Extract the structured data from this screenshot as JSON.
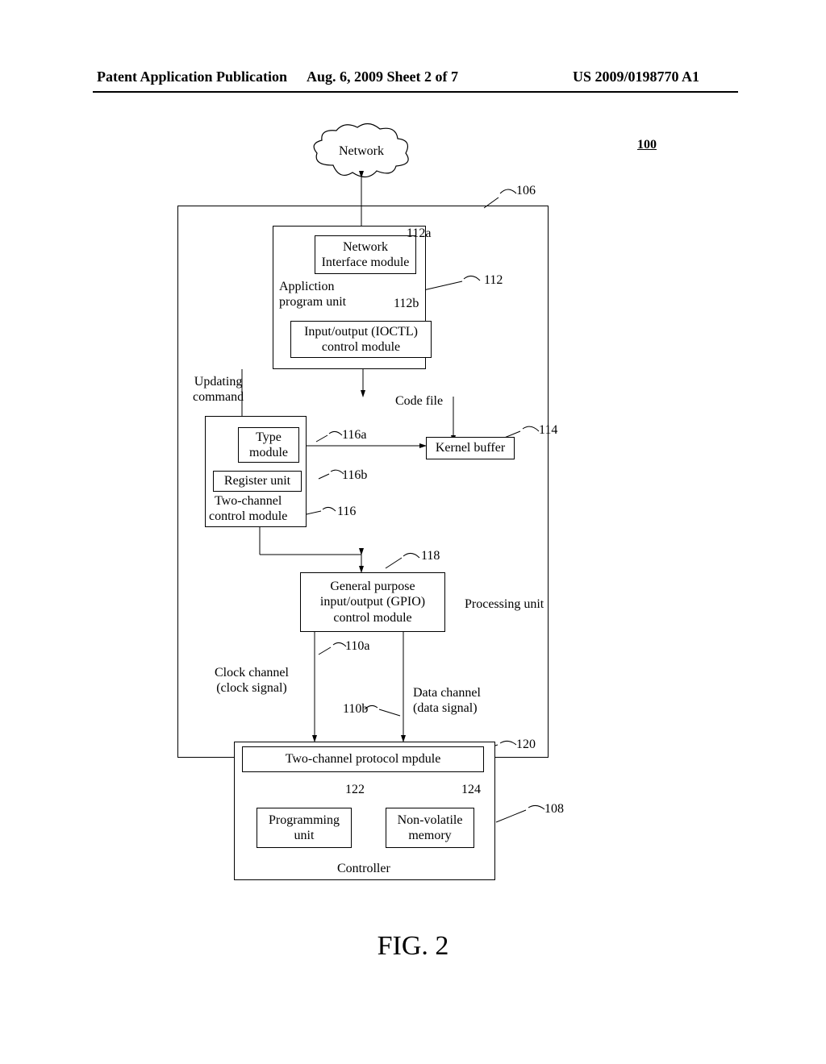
{
  "header": {
    "left": "Patent Application Publication",
    "center": "Aug. 6, 2009  Sheet 2 of 7",
    "right": "US 2009/0198770 A1"
  },
  "figure_caption": "FIG. 2",
  "refs": {
    "r100": "100",
    "r106": "106",
    "r108": "108",
    "r110a": "110a",
    "r110b": "110b",
    "r112": "112",
    "r112a": "112a",
    "r112b": "112b",
    "r114": "114",
    "r116": "116",
    "r116a": "116a",
    "r116b": "116b",
    "r118": "118",
    "r120": "120",
    "r122": "122",
    "r124": "124"
  },
  "blocks": {
    "network": "Network",
    "network_if": "Network\nInterface module",
    "app_unit": "Appliction\nprogram unit",
    "ioctl": "Input/output (IOCTL)\ncontrol module",
    "updating_cmd": "Updating\ncommand",
    "type_mod": "Type\nmodule",
    "register_unit": "Register unit",
    "two_ch_ctrl": "Two-channel\ncontrol module",
    "code_file": "Code file",
    "kernel_buf": "Kernel buffer",
    "gpio": "General purpose\ninput/output (GPIO)\ncontrol module",
    "processing_unit": "Processing unit",
    "clock_ch": "Clock channel\n(clock signal)",
    "data_ch": "Data channel\n(data signal)",
    "two_ch_proto": "Two-channel protocol mpdule",
    "programming_unit": "Programming\nunit",
    "nv_mem": "Non-volatile\nmemory",
    "controller": "Controller"
  }
}
